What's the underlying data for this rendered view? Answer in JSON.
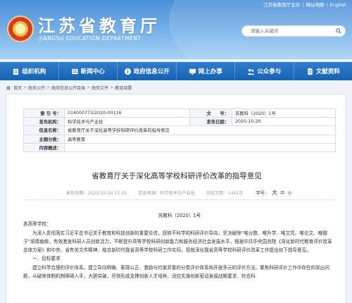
{
  "header": {
    "toplinks": [
      "江苏省教育厅主办",
      "网站地图",
      "English"
    ],
    "title": "江苏省教育厅",
    "subtitle": "JIANGSU EDUCATION DEPARTMENT",
    "search_placeholder": "请输入关键词"
  },
  "nav": {
    "items": [
      {
        "label": "组织机构",
        "icon": "building-icon"
      },
      {
        "label": "新闻中心",
        "icon": "news-icon"
      },
      {
        "label": "政府信息公开",
        "icon": "info-icon"
      },
      {
        "label": "网上办事",
        "icon": "monitor-icon"
      },
      {
        "label": "公众参与",
        "icon": "people-icon"
      },
      {
        "label": "文献资料",
        "icon": "document-icon"
      }
    ]
  },
  "breadcrumb": [
    "首页",
    "政务公开",
    "政府信息公开目录",
    "政府文件",
    "教育部署"
  ],
  "meta": {
    "index_label": "索 引 号：",
    "index_value": "014000773/2020-00116",
    "docno_label": "文　　号：",
    "docno_value": "苏教科〔2020〕1号",
    "org_label": "发布机构：",
    "org_value": "科学技术与产业处",
    "date_label": "发布日期：",
    "date_value": "2020-10-20",
    "name_label": "信息名称：",
    "name_value": "省教育厅关于深化高等学校科研评价改革的指导意见",
    "cat_label": "主题分类：",
    "cat_value": "高等教育",
    "summary_label": "内容概述：",
    "summary_value": ""
  },
  "article": {
    "title": "省教育厅关于深化高等学校科研评价改革的指导意见",
    "published": "发布日期：2020-10-20 15:31",
    "source": "信息来源：科学技术与产业处",
    "views": "浏览次数：1441次",
    "fontsize_label": "字号：",
    "fontsize_big": "大",
    "fontsize_mid": "中",
    "fontsize_small": "小",
    "docno": "苏教科〔2020〕1号",
    "salutation": "各高等学校：",
    "para1": "为深入贯彻落实习近平总书记关于教育和科技创新的重要论述，扭转不科学的科研评价导向，坚决破除“唯分数、唯升学、唯文凭、唯论文、唯帽子”顽瘴痼疾，有效激发科研人员创新活力，不断提升高等学校科研创新能力和服务经济社会发展水平，根据中共中央国务院《深化新时代教育评价改革总体方案》和中央、省有关文件精神，结合新时代我省高等学校科研工作实际，现就深化我省高等学校科研评价改革工作提出如下指导意见。",
    "section1": "一、目标要求",
    "para2": "建立科学合理的评价体系。建立导向明确、客观公正、激励与约束并重的分类评价体系和开放多元的评价方法。聚焦科研评价工作中存在的突出问题，从破除体制机制障碍入手，大胆突破，尽快形成支撑创新人才培养、适应实施创新驱动发展战略要求、符合科"
  }
}
